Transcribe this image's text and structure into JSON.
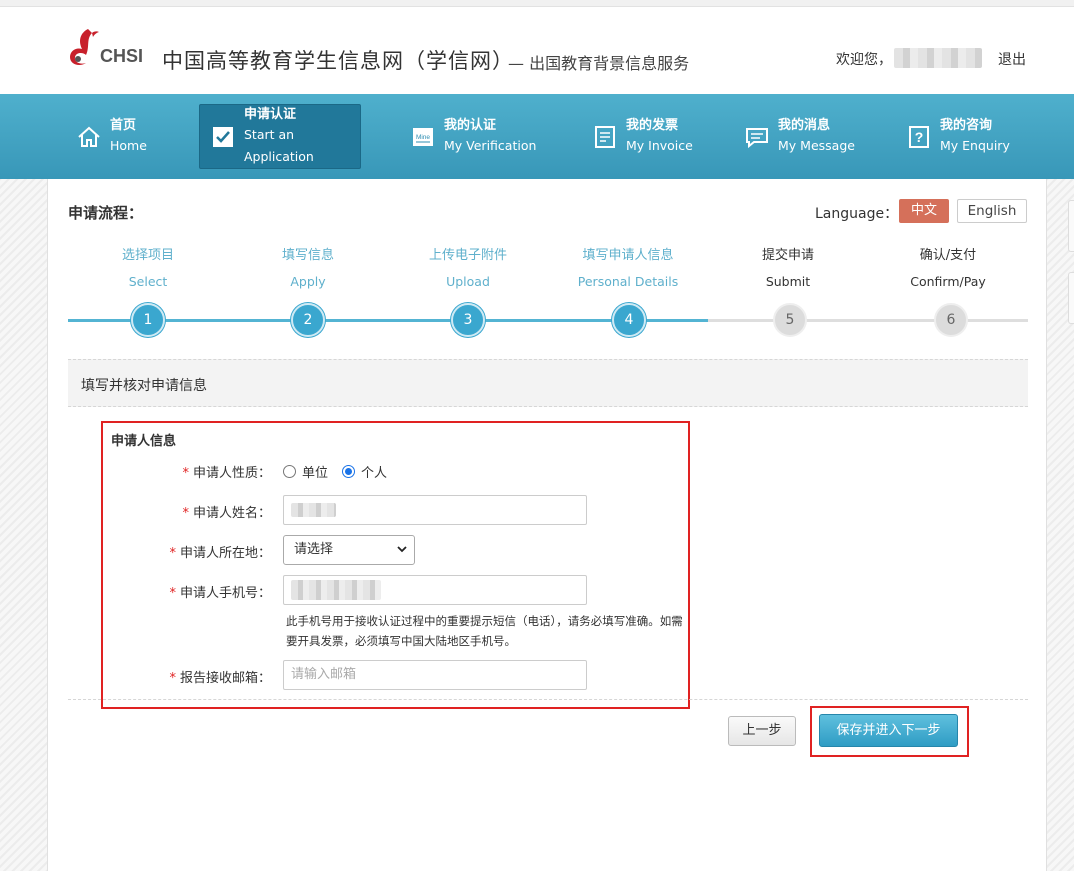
{
  "header": {
    "logo_text": "CHSI",
    "site_title": "中国高等教育学生信息网（学信网）",
    "site_subtitle": "— 出国教育背景信息服务",
    "welcome": "欢迎您，",
    "logout": "退出"
  },
  "nav": [
    {
      "cn": "首页",
      "en": "Home",
      "icon": "home-icon"
    },
    {
      "cn": "申请认证",
      "en": "Start an Application",
      "icon": "checkbox-icon"
    },
    {
      "cn": "我的认证",
      "en": "My Verification",
      "icon": "mine-icon"
    },
    {
      "cn": "我的发票",
      "en": "My Invoice",
      "icon": "invoice-icon"
    },
    {
      "cn": "我的消息",
      "en": "My Message",
      "icon": "message-icon"
    },
    {
      "cn": "我的咨询",
      "en": "My Enquiry",
      "icon": "question-icon"
    }
  ],
  "process": {
    "title": "申请流程：",
    "language_label": "Language：",
    "lang_zh": "中文",
    "lang_en": "English",
    "steps": [
      {
        "cn": "选择项目",
        "en": "Select",
        "num": "1",
        "status": "done"
      },
      {
        "cn": "填写信息",
        "en": "Apply",
        "num": "2",
        "status": "done"
      },
      {
        "cn": "上传电子附件",
        "en": "Upload",
        "num": "3",
        "status": "done"
      },
      {
        "cn": "填写申请人信息",
        "en": "Personal Details",
        "num": "4",
        "status": "done"
      },
      {
        "cn": "提交申请",
        "en": "Submit",
        "num": "5",
        "status": "todo"
      },
      {
        "cn": "确认/支付",
        "en": "Confirm/Pay",
        "num": "6",
        "status": "todo"
      }
    ]
  },
  "form": {
    "section_title": "填写并核对申请信息",
    "group_title": "申请人信息",
    "required_mark": "*",
    "type_label": "申请人性质：",
    "type_options": [
      "单位",
      "个人"
    ],
    "type_selected": "个人",
    "name_label": "申请人姓名：",
    "location_label": "申请人所在地：",
    "location_value": "请选择",
    "phone_label": "申请人手机号：",
    "phone_hint": "此手机号用于接收认证过程中的重要提示短信（电话），请务必填写准确。如需要开具发票，必须填写中国大陆地区手机号。",
    "email_label": "报告接收邮箱：",
    "email_placeholder": "请输入邮箱"
  },
  "buttons": {
    "prev": "上一步",
    "next": "保存并进入下一步"
  },
  "colors": {
    "nav_bg": "#3fa3c4",
    "nav_active": "#21789a",
    "step_done": "#3aa7cf",
    "lang_active": "#d5705a",
    "highlight": "#e02222"
  }
}
